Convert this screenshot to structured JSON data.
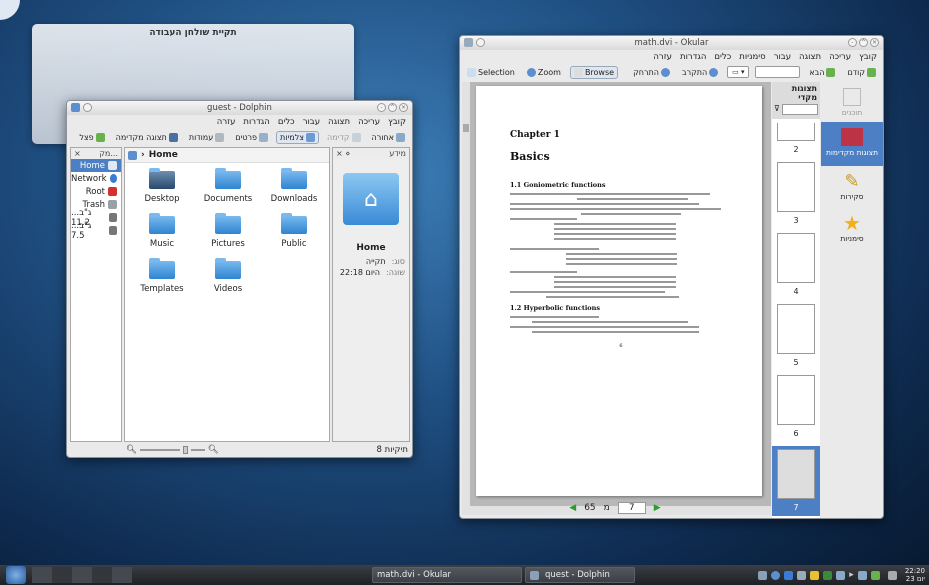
{
  "desktop": {
    "folderview_title": "תקיית שולחן העבודה"
  },
  "dolphin": {
    "title": "guest - Dolphin",
    "menu": [
      "קובץ",
      "עריכה",
      "תצוגה",
      "עבור",
      "כלים",
      "הגדרות",
      "עזרה"
    ],
    "toolbar": {
      "back": "אחורה",
      "forward": "קדימה",
      "icons": "צלמיות",
      "details": "פרטים",
      "columns": "עמודות",
      "preview": "תצוגה מקדימה",
      "split": "פצל"
    },
    "places_header": "מק...",
    "places": [
      {
        "label": "Home",
        "icon": "home-icon",
        "selected": true
      },
      {
        "label": "Network",
        "icon": "network-icon"
      },
      {
        "label": "Root",
        "icon": "root-icon"
      },
      {
        "label": "Trash",
        "icon": "trash-icon"
      },
      {
        "label": "...ג\"ב 11.2",
        "icon": "drive-icon"
      },
      {
        "label": "...ג\"ב 7.5",
        "icon": "drive-icon"
      }
    ],
    "breadcrumb": "Home",
    "files": [
      "Desktop",
      "Documents",
      "Downloads",
      "Music",
      "Pictures",
      "Public",
      "Templates",
      "Videos"
    ],
    "info": {
      "header": "מידע",
      "name": "Home",
      "type_label": "סוג:",
      "type_value": "תקייה",
      "modified_label": "שונה:",
      "modified_value": "היום 22:18"
    },
    "status": "8 תיקיות"
  },
  "okular": {
    "title": "math.dvi - Okular",
    "menu": [
      "קובץ",
      "עריכה",
      "תצוגה",
      "עבור",
      "סימניות",
      "כלים",
      "הגדרות",
      "עזרה"
    ],
    "toolbar": {
      "previous": "קודם",
      "next": "הבא",
      "zoom_in": "התקרב",
      "zoom_out": "התרחק",
      "browse": "Browse",
      "zoom": "Zoom",
      "selection": "Selection"
    },
    "thumb_header": "תצוגות מקדי",
    "thumbs": [
      "2",
      "3",
      "4",
      "5",
      "6",
      "7"
    ],
    "side": [
      {
        "label": "תוכנים",
        "icon": "contents-icon"
      },
      {
        "label": "תצוגות מקדימות",
        "icon": "thumbnails-icon",
        "active": true
      },
      {
        "label": "סקירות",
        "icon": "pencil-icon"
      },
      {
        "label": "סימניות",
        "icon": "star-icon"
      }
    ],
    "page": {
      "chapter": "Chapter 1",
      "heading": "Basics",
      "s11": "1.1   Goniometric functions",
      "s12": "1.2   Hyperbolic functions",
      "pageno": "6"
    },
    "nav": {
      "current": "7",
      "of": "מ",
      "total": "65"
    }
  },
  "taskbar": {
    "tasks": [
      "math.dvi - Okular",
      "quest - Dolphin"
    ],
    "time": "22:20",
    "date": "יום 23"
  }
}
